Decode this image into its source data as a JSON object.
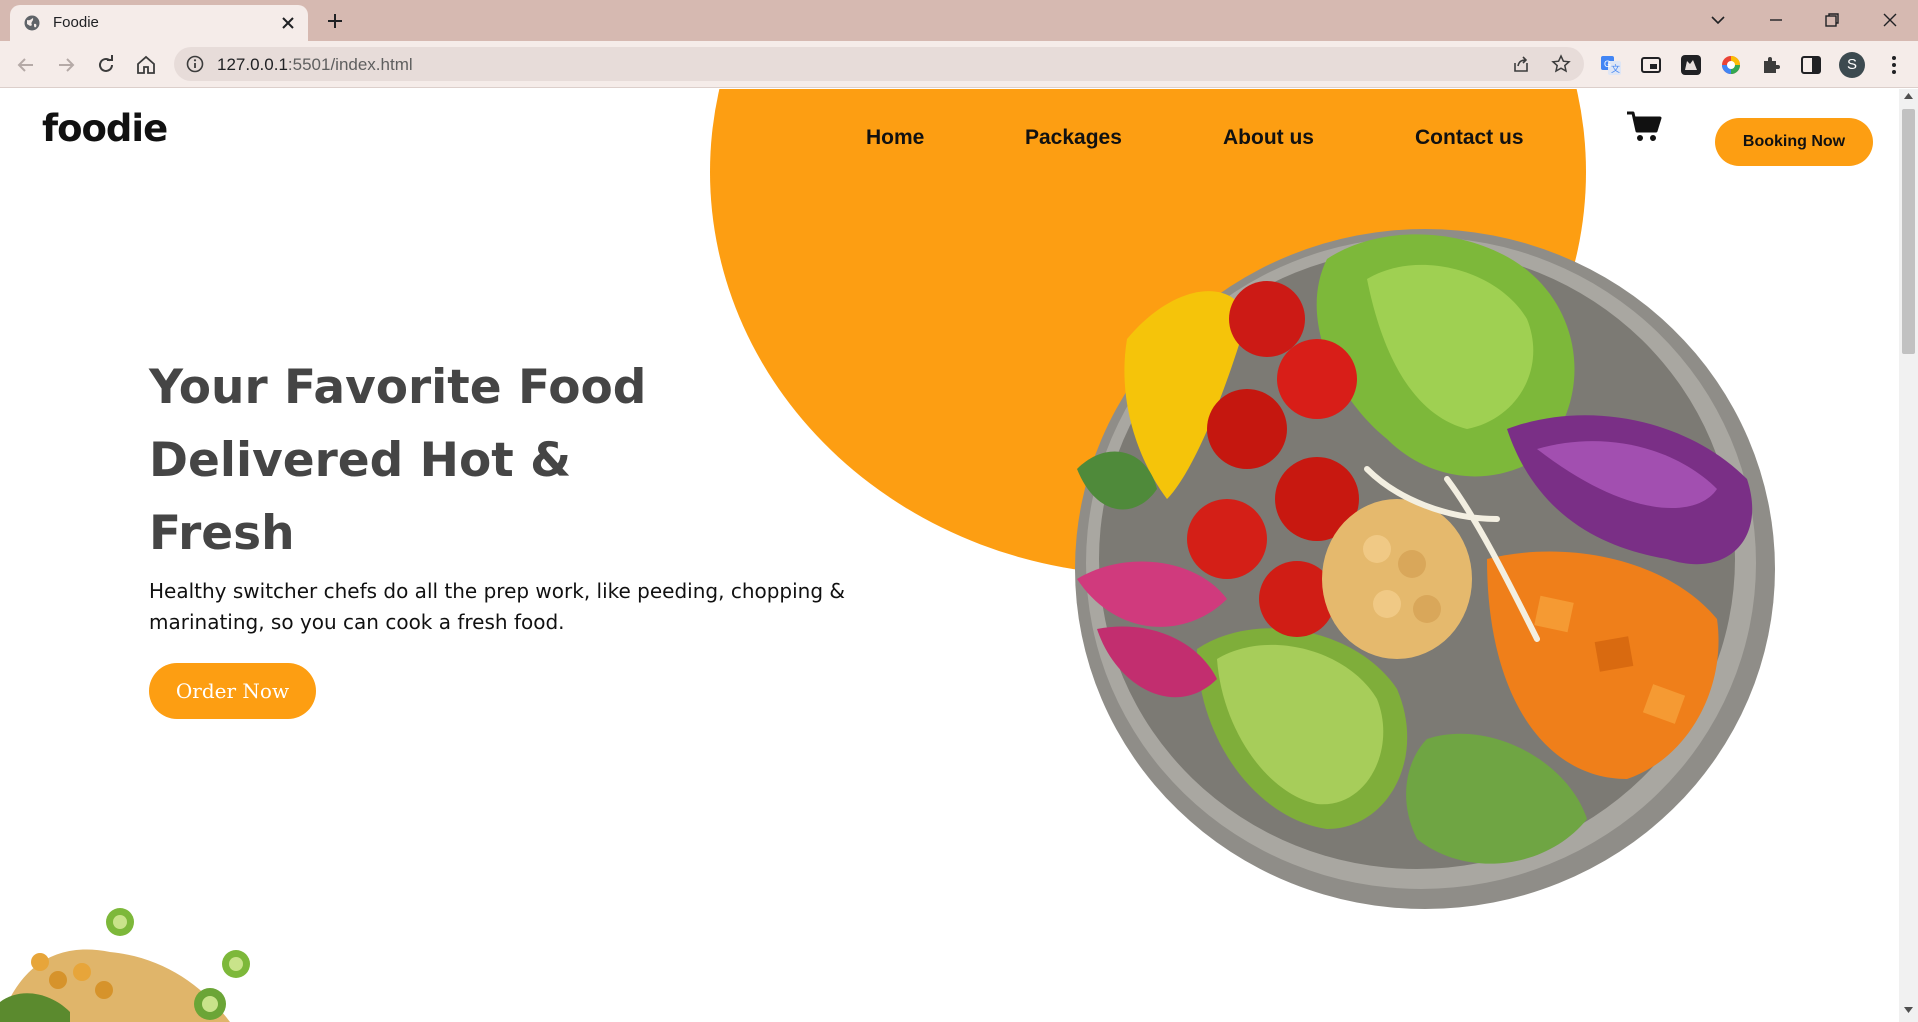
{
  "browser": {
    "tab_title": "Foodie",
    "url_host": "127.0.0.1",
    "url_rest": ":5501/index.html",
    "profile_initial": "S"
  },
  "site": {
    "logo": "foodie",
    "nav": {
      "home": "Home",
      "packages": "Packages",
      "about": "About us",
      "contact": "Contact us"
    },
    "booking_label": "Booking Now"
  },
  "hero": {
    "title_line1": "Your Favorite Food",
    "title_line2": "Delivered Hot &",
    "title_line3": "Fresh",
    "text_line1": "Healthy switcher chefs do all the prep work, like peeding, chopping &",
    "text_line2": "marinating, so you can cook a fresh food.",
    "order_label": "Order Now"
  },
  "colors": {
    "accent": "#fd9e12",
    "chrome_tabbar": "#d6b9b1",
    "chrome_toolbar": "#f5ece9",
    "heading": "#454545"
  }
}
